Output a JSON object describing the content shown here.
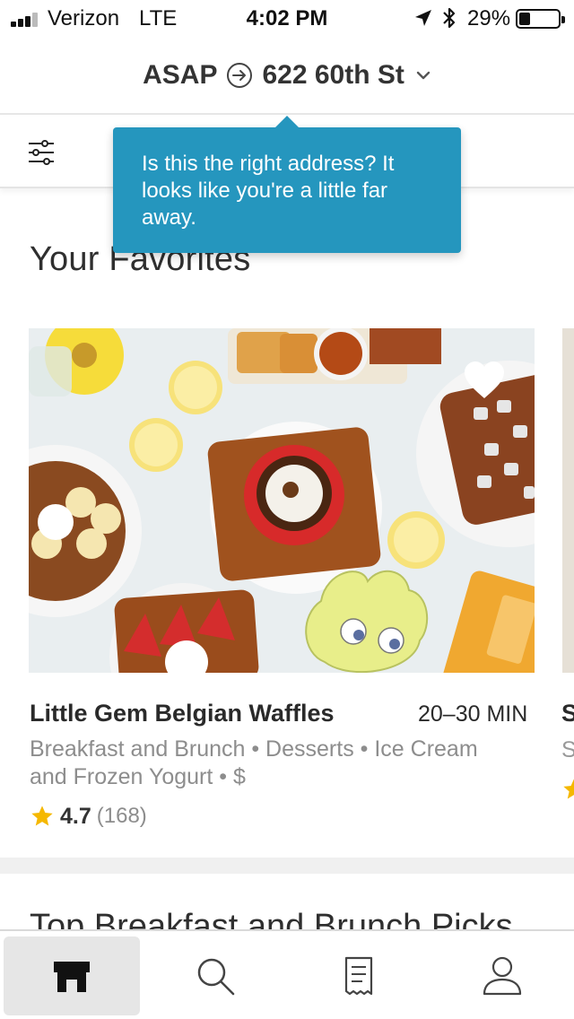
{
  "status_bar": {
    "carrier": "Verizon",
    "network": "LTE",
    "time": "4:02 PM",
    "battery": "29%",
    "battery_level": 0.29
  },
  "header": {
    "asap": "ASAP",
    "address": "622 60th St"
  },
  "tooltip": {
    "text": "Is this the right address? It looks like you're a little far away."
  },
  "favorites": {
    "title": "Your Favorites",
    "restaurant": {
      "name": "Little Gem Belgian Waffles",
      "delivery_time": "20–30 MIN",
      "categories": "Breakfast and Brunch • Desserts • Ice Cream and Frozen Yogurt • $",
      "rating": "4.7",
      "rating_count": "(168)",
      "favorited": true
    },
    "peek": {
      "name_initial": "S",
      "sub_initial": "S"
    }
  },
  "next_section": {
    "title": "Top Breakfast and Brunch Picks"
  },
  "tabs": [
    {
      "name": "home",
      "icon": "storefront-icon",
      "active": true
    },
    {
      "name": "search",
      "icon": "search-icon",
      "active": false
    },
    {
      "name": "orders",
      "icon": "receipt-icon",
      "active": false
    },
    {
      "name": "account",
      "icon": "person-icon",
      "active": false
    }
  ],
  "colors": {
    "tooltip_bg": "#2596be",
    "star": "#f5b800",
    "active_tab_bg": "#e6e6e6"
  }
}
